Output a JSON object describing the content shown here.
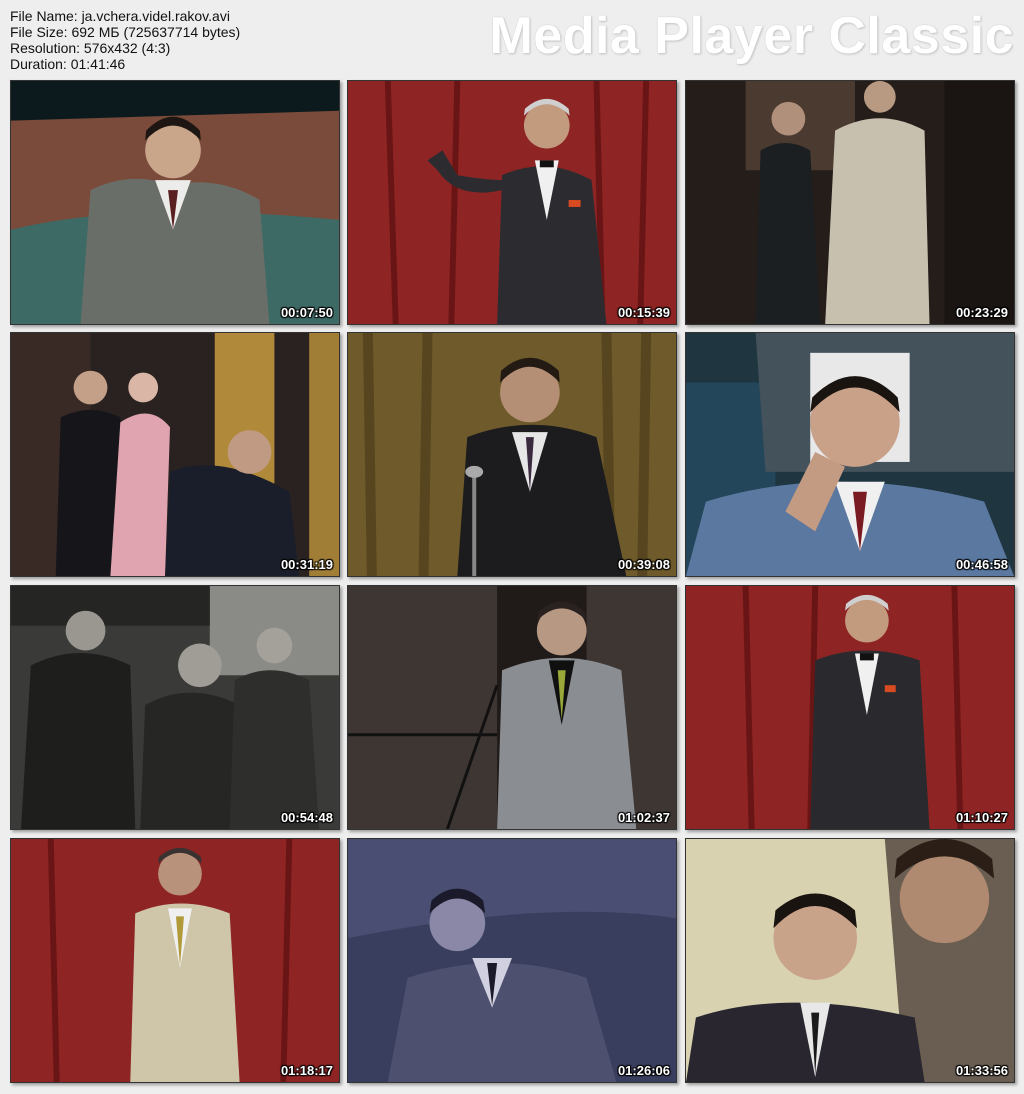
{
  "info": {
    "file_name": "File Name: ja.vchera.videl.rakov.avi",
    "file_size": "File Size: 692 МБ (725637714 bytes)",
    "resolution": "Resolution: 576x432 (4:3)",
    "duration": "Duration: 01:41:46"
  },
  "brand": "Media Player Classic",
  "thumbnails": [
    {
      "time": "00:07:50"
    },
    {
      "time": "00:15:39"
    },
    {
      "time": "00:23:29"
    },
    {
      "time": "00:31:19"
    },
    {
      "time": "00:39:08"
    },
    {
      "time": "00:46:58"
    },
    {
      "time": "00:54:48"
    },
    {
      "time": "01:02:37"
    },
    {
      "time": "01:10:27"
    },
    {
      "time": "01:18:17"
    },
    {
      "time": "01:26:06"
    },
    {
      "time": "01:33:56"
    }
  ]
}
